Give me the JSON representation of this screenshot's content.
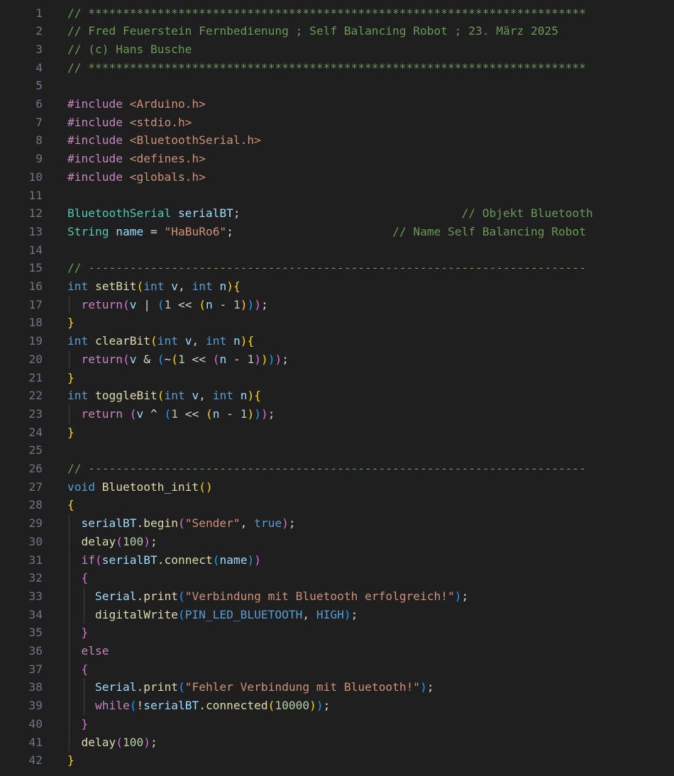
{
  "editor": {
    "lines": [
      {
        "n": "1",
        "indent": 0,
        "tokens": [
          {
            "t": "// ************************************************************************",
            "c": "com"
          }
        ]
      },
      {
        "n": "2",
        "indent": 0,
        "tokens": [
          {
            "t": "// Fred Feuerstein Fernbedienung ; Self Balancing Robot ; 23. März 2025",
            "c": "com"
          }
        ]
      },
      {
        "n": "3",
        "indent": 0,
        "tokens": [
          {
            "t": "// (c) Hans Busche",
            "c": "com"
          }
        ]
      },
      {
        "n": "4",
        "indent": 0,
        "tokens": [
          {
            "t": "// ************************************************************************",
            "c": "com"
          }
        ]
      },
      {
        "n": "5",
        "indent": 0,
        "tokens": []
      },
      {
        "n": "6",
        "indent": 0,
        "tokens": [
          {
            "t": "#include ",
            "c": "pp"
          },
          {
            "t": "<Arduino.h>",
            "c": "inc"
          }
        ]
      },
      {
        "n": "7",
        "indent": 0,
        "tokens": [
          {
            "t": "#include ",
            "c": "pp"
          },
          {
            "t": "<stdio.h>",
            "c": "inc"
          }
        ]
      },
      {
        "n": "8",
        "indent": 0,
        "tokens": [
          {
            "t": "#include ",
            "c": "pp"
          },
          {
            "t": "<BluetoothSerial.h>",
            "c": "inc"
          }
        ]
      },
      {
        "n": "9",
        "indent": 0,
        "tokens": [
          {
            "t": "#include ",
            "c": "pp"
          },
          {
            "t": "<defines.h>",
            "c": "inc"
          }
        ]
      },
      {
        "n": "10",
        "indent": 0,
        "tokens": [
          {
            "t": "#include ",
            "c": "pp"
          },
          {
            "t": "<globals.h>",
            "c": "inc"
          }
        ]
      },
      {
        "n": "11",
        "indent": 0,
        "tokens": []
      },
      {
        "n": "12",
        "indent": 0,
        "tokens": [
          {
            "t": "BluetoothSerial",
            "c": "type"
          },
          {
            "t": " ",
            "c": "plain"
          },
          {
            "t": "serialBT",
            "c": "var"
          },
          {
            "t": ";                                ",
            "c": "plain"
          },
          {
            "t": "// Objekt Bluetooth",
            "c": "com"
          }
        ]
      },
      {
        "n": "13",
        "indent": 0,
        "tokens": [
          {
            "t": "String",
            "c": "type"
          },
          {
            "t": " ",
            "c": "plain"
          },
          {
            "t": "name",
            "c": "var"
          },
          {
            "t": " = ",
            "c": "plain"
          },
          {
            "t": "\"HaBuRo6\"",
            "c": "str"
          },
          {
            "t": ";                       ",
            "c": "plain"
          },
          {
            "t": "// Name Self Balancing Robot",
            "c": "com"
          }
        ]
      },
      {
        "n": "14",
        "indent": 0,
        "tokens": []
      },
      {
        "n": "15",
        "indent": 0,
        "tokens": [
          {
            "t": "// ------------------------------------------------------------------------",
            "c": "com"
          }
        ]
      },
      {
        "n": "16",
        "indent": 0,
        "tokens": [
          {
            "t": "int",
            "c": "kw"
          },
          {
            "t": " ",
            "c": "plain"
          },
          {
            "t": "setBit",
            "c": "fn"
          },
          {
            "t": "(",
            "c": "b1"
          },
          {
            "t": "int",
            "c": "kw"
          },
          {
            "t": " ",
            "c": "plain"
          },
          {
            "t": "v",
            "c": "var"
          },
          {
            "t": ", ",
            "c": "plain"
          },
          {
            "t": "int",
            "c": "kw"
          },
          {
            "t": " ",
            "c": "plain"
          },
          {
            "t": "n",
            "c": "var"
          },
          {
            "t": ")",
            "c": "b1"
          },
          {
            "t": "{",
            "c": "b1"
          }
        ]
      },
      {
        "n": "17",
        "indent": 1,
        "tokens": [
          {
            "t": "  ",
            "c": "plain"
          },
          {
            "t": "return",
            "c": "ctrl"
          },
          {
            "t": "(",
            "c": "b2"
          },
          {
            "t": "v",
            "c": "var"
          },
          {
            "t": " | ",
            "c": "plain"
          },
          {
            "t": "(",
            "c": "b3"
          },
          {
            "t": "1",
            "c": "num"
          },
          {
            "t": " << ",
            "c": "plain"
          },
          {
            "t": "(",
            "c": "b1"
          },
          {
            "t": "n",
            "c": "var"
          },
          {
            "t": " - ",
            "c": "plain"
          },
          {
            "t": "1",
            "c": "num"
          },
          {
            "t": ")",
            "c": "b1"
          },
          {
            "t": ")",
            "c": "b3"
          },
          {
            "t": ")",
            "c": "b2"
          },
          {
            "t": ";",
            "c": "plain"
          }
        ]
      },
      {
        "n": "18",
        "indent": 0,
        "tokens": [
          {
            "t": "}",
            "c": "b1"
          }
        ]
      },
      {
        "n": "19",
        "indent": 0,
        "tokens": [
          {
            "t": "int",
            "c": "kw"
          },
          {
            "t": " ",
            "c": "plain"
          },
          {
            "t": "clearBit",
            "c": "fn"
          },
          {
            "t": "(",
            "c": "b1"
          },
          {
            "t": "int",
            "c": "kw"
          },
          {
            "t": " ",
            "c": "plain"
          },
          {
            "t": "v",
            "c": "var"
          },
          {
            "t": ", ",
            "c": "plain"
          },
          {
            "t": "int",
            "c": "kw"
          },
          {
            "t": " ",
            "c": "plain"
          },
          {
            "t": "n",
            "c": "var"
          },
          {
            "t": ")",
            "c": "b1"
          },
          {
            "t": "{",
            "c": "b1"
          }
        ]
      },
      {
        "n": "20",
        "indent": 1,
        "tokens": [
          {
            "t": "  ",
            "c": "plain"
          },
          {
            "t": "return",
            "c": "ctrl"
          },
          {
            "t": "(",
            "c": "b2"
          },
          {
            "t": "v",
            "c": "var"
          },
          {
            "t": " & ",
            "c": "plain"
          },
          {
            "t": "(",
            "c": "b3"
          },
          {
            "t": "~",
            "c": "plain"
          },
          {
            "t": "(",
            "c": "b1"
          },
          {
            "t": "1",
            "c": "num"
          },
          {
            "t": " << ",
            "c": "plain"
          },
          {
            "t": "(",
            "c": "b2"
          },
          {
            "t": "n",
            "c": "var"
          },
          {
            "t": " - ",
            "c": "plain"
          },
          {
            "t": "1",
            "c": "num"
          },
          {
            "t": ")",
            "c": "b2"
          },
          {
            "t": ")",
            "c": "b1"
          },
          {
            "t": ")",
            "c": "b3"
          },
          {
            "t": ")",
            "c": "b2"
          },
          {
            "t": ";",
            "c": "plain"
          }
        ]
      },
      {
        "n": "21",
        "indent": 0,
        "tokens": [
          {
            "t": "}",
            "c": "b1"
          }
        ]
      },
      {
        "n": "22",
        "indent": 0,
        "tokens": [
          {
            "t": "int",
            "c": "kw"
          },
          {
            "t": " ",
            "c": "plain"
          },
          {
            "t": "toggleBit",
            "c": "fn"
          },
          {
            "t": "(",
            "c": "b1"
          },
          {
            "t": "int",
            "c": "kw"
          },
          {
            "t": " ",
            "c": "plain"
          },
          {
            "t": "v",
            "c": "var"
          },
          {
            "t": ", ",
            "c": "plain"
          },
          {
            "t": "int",
            "c": "kw"
          },
          {
            "t": " ",
            "c": "plain"
          },
          {
            "t": "n",
            "c": "var"
          },
          {
            "t": ")",
            "c": "b1"
          },
          {
            "t": "{",
            "c": "b1"
          }
        ]
      },
      {
        "n": "23",
        "indent": 1,
        "tokens": [
          {
            "t": "  ",
            "c": "plain"
          },
          {
            "t": "return",
            "c": "ctrl"
          },
          {
            "t": " ",
            "c": "plain"
          },
          {
            "t": "(",
            "c": "b2"
          },
          {
            "t": "v",
            "c": "var"
          },
          {
            "t": " ^ ",
            "c": "plain"
          },
          {
            "t": "(",
            "c": "b3"
          },
          {
            "t": "1",
            "c": "num"
          },
          {
            "t": " << ",
            "c": "plain"
          },
          {
            "t": "(",
            "c": "b1"
          },
          {
            "t": "n",
            "c": "var"
          },
          {
            "t": " - ",
            "c": "plain"
          },
          {
            "t": "1",
            "c": "num"
          },
          {
            "t": ")",
            "c": "b1"
          },
          {
            "t": ")",
            "c": "b3"
          },
          {
            "t": ")",
            "c": "b2"
          },
          {
            "t": ";",
            "c": "plain"
          }
        ]
      },
      {
        "n": "24",
        "indent": 0,
        "tokens": [
          {
            "t": "}",
            "c": "b1"
          }
        ]
      },
      {
        "n": "25",
        "indent": 0,
        "tokens": []
      },
      {
        "n": "26",
        "indent": 0,
        "tokens": [
          {
            "t": "// ------------------------------------------------------------------------",
            "c": "com"
          }
        ]
      },
      {
        "n": "27",
        "indent": 0,
        "tokens": [
          {
            "t": "void",
            "c": "kw"
          },
          {
            "t": " ",
            "c": "plain"
          },
          {
            "t": "Bluetooth_init",
            "c": "fn"
          },
          {
            "t": "(",
            "c": "b1"
          },
          {
            "t": ")",
            "c": "b1"
          }
        ]
      },
      {
        "n": "28",
        "indent": 0,
        "tokens": [
          {
            "t": "{",
            "c": "b1"
          }
        ]
      },
      {
        "n": "29",
        "indent": 1,
        "tokens": [
          {
            "t": "  ",
            "c": "plain"
          },
          {
            "t": "serialBT",
            "c": "var"
          },
          {
            "t": ".",
            "c": "plain"
          },
          {
            "t": "begin",
            "c": "fn"
          },
          {
            "t": "(",
            "c": "b2"
          },
          {
            "t": "\"Sender\"",
            "c": "str"
          },
          {
            "t": ", ",
            "c": "plain"
          },
          {
            "t": "true",
            "c": "kw"
          },
          {
            "t": ")",
            "c": "b2"
          },
          {
            "t": ";",
            "c": "plain"
          }
        ]
      },
      {
        "n": "30",
        "indent": 1,
        "tokens": [
          {
            "t": "  ",
            "c": "plain"
          },
          {
            "t": "delay",
            "c": "fn"
          },
          {
            "t": "(",
            "c": "b2"
          },
          {
            "t": "100",
            "c": "num"
          },
          {
            "t": ")",
            "c": "b2"
          },
          {
            "t": ";",
            "c": "plain"
          }
        ]
      },
      {
        "n": "31",
        "indent": 1,
        "tokens": [
          {
            "t": "  ",
            "c": "plain"
          },
          {
            "t": "if",
            "c": "ctrl"
          },
          {
            "t": "(",
            "c": "b2"
          },
          {
            "t": "serialBT",
            "c": "var"
          },
          {
            "t": ".",
            "c": "plain"
          },
          {
            "t": "connect",
            "c": "fn"
          },
          {
            "t": "(",
            "c": "b3"
          },
          {
            "t": "name",
            "c": "var"
          },
          {
            "t": ")",
            "c": "b3"
          },
          {
            "t": ")",
            "c": "b2"
          }
        ]
      },
      {
        "n": "32",
        "indent": 1,
        "tokens": [
          {
            "t": "  ",
            "c": "plain"
          },
          {
            "t": "{",
            "c": "b2"
          }
        ]
      },
      {
        "n": "33",
        "indent": 2,
        "tokens": [
          {
            "t": "    ",
            "c": "plain"
          },
          {
            "t": "Serial",
            "c": "var"
          },
          {
            "t": ".",
            "c": "plain"
          },
          {
            "t": "print",
            "c": "fn"
          },
          {
            "t": "(",
            "c": "b3"
          },
          {
            "t": "\"Verbindung mit Bluetooth erfolgreich!\"",
            "c": "str"
          },
          {
            "t": ")",
            "c": "b3"
          },
          {
            "t": ";",
            "c": "plain"
          }
        ]
      },
      {
        "n": "34",
        "indent": 2,
        "tokens": [
          {
            "t": "    ",
            "c": "plain"
          },
          {
            "t": "digitalWrite",
            "c": "fn"
          },
          {
            "t": "(",
            "c": "b3"
          },
          {
            "t": "PIN_LED_BLUETOOTH",
            "c": "kw"
          },
          {
            "t": ", ",
            "c": "plain"
          },
          {
            "t": "HIGH",
            "c": "kw"
          },
          {
            "t": ")",
            "c": "b3"
          },
          {
            "t": ";",
            "c": "plain"
          }
        ]
      },
      {
        "n": "35",
        "indent": 1,
        "tokens": [
          {
            "t": "  ",
            "c": "plain"
          },
          {
            "t": "}",
            "c": "b2"
          }
        ]
      },
      {
        "n": "36",
        "indent": 1,
        "tokens": [
          {
            "t": "  ",
            "c": "plain"
          },
          {
            "t": "else",
            "c": "ctrl"
          }
        ]
      },
      {
        "n": "37",
        "indent": 1,
        "tokens": [
          {
            "t": "  ",
            "c": "plain"
          },
          {
            "t": "{",
            "c": "b2"
          }
        ]
      },
      {
        "n": "38",
        "indent": 2,
        "tokens": [
          {
            "t": "    ",
            "c": "plain"
          },
          {
            "t": "Serial",
            "c": "var"
          },
          {
            "t": ".",
            "c": "plain"
          },
          {
            "t": "print",
            "c": "fn"
          },
          {
            "t": "(",
            "c": "b3"
          },
          {
            "t": "\"Fehler Verbindung mit Bluetooth!\"",
            "c": "str"
          },
          {
            "t": ")",
            "c": "b3"
          },
          {
            "t": ";",
            "c": "plain"
          }
        ]
      },
      {
        "n": "39",
        "indent": 2,
        "tokens": [
          {
            "t": "    ",
            "c": "plain"
          },
          {
            "t": "while",
            "c": "ctrl"
          },
          {
            "t": "(",
            "c": "b3"
          },
          {
            "t": "!",
            "c": "plain"
          },
          {
            "t": "serialBT",
            "c": "var"
          },
          {
            "t": ".",
            "c": "plain"
          },
          {
            "t": "connected",
            "c": "fn"
          },
          {
            "t": "(",
            "c": "b1"
          },
          {
            "t": "10000",
            "c": "num"
          },
          {
            "t": ")",
            "c": "b1"
          },
          {
            "t": ")",
            "c": "b3"
          },
          {
            "t": ";",
            "c": "plain"
          }
        ]
      },
      {
        "n": "40",
        "indent": 1,
        "tokens": [
          {
            "t": "  ",
            "c": "plain"
          },
          {
            "t": "}",
            "c": "b2"
          }
        ]
      },
      {
        "n": "41",
        "indent": 1,
        "tokens": [
          {
            "t": "  ",
            "c": "plain"
          },
          {
            "t": "delay",
            "c": "fn"
          },
          {
            "t": "(",
            "c": "b2"
          },
          {
            "t": "100",
            "c": "num"
          },
          {
            "t": ")",
            "c": "b2"
          },
          {
            "t": ";",
            "c": "plain"
          }
        ]
      },
      {
        "n": "42",
        "indent": 0,
        "tokens": [
          {
            "t": "}",
            "c": "b1"
          }
        ]
      }
    ]
  }
}
